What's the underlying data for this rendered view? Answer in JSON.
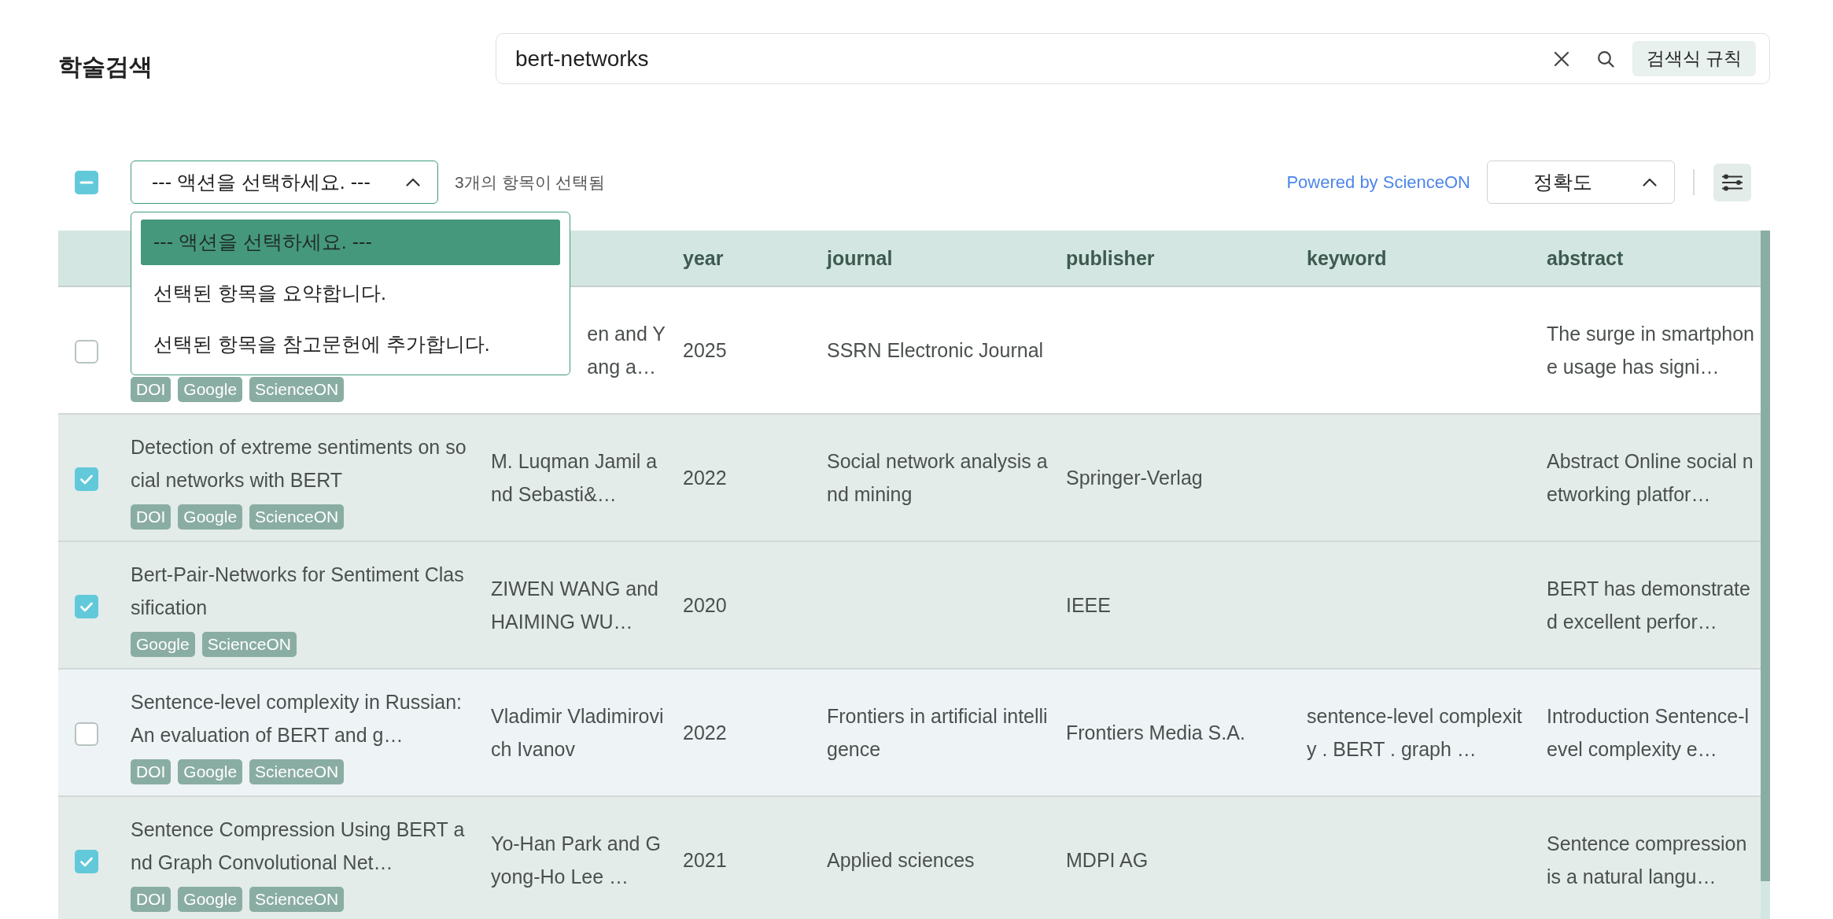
{
  "page_title": "학술검색",
  "search": {
    "value": "bert-networks",
    "rules_button": "검색식 규칙"
  },
  "toolbar": {
    "select_all": {
      "indeterminate": true
    },
    "action_select": {
      "value": "--- 액션을 선택하세요. ---",
      "expanded": true,
      "options": [
        {
          "label": "--- 액션을 선택하세요. ---",
          "selected": true
        },
        {
          "label": "선택된 항목을 요약합니다.",
          "selected": false
        },
        {
          "label": "선택된 항목을 참고문헌에 추가합니다.",
          "selected": false
        }
      ]
    },
    "selection_count": "3개의 항목이 선택됨",
    "powered_by": "Powered by ScienceON",
    "sort_select": {
      "value": "정확도"
    }
  },
  "table": {
    "columns": [
      "year",
      "journal",
      "publisher",
      "keyword",
      "abstract"
    ],
    "rows": [
      {
        "selected": false,
        "column_1": {
          "links": [
            "DOI",
            "Google",
            "ScienceON"
          ]
        },
        "column_2": "en and Y\nang a…",
        "cells": [
          "2025",
          "SSRN Electronic Journal",
          null,
          null,
          "The surge in smartphone usage has signi…"
        ]
      },
      {
        "selected": true,
        "column_1": {
          "text": "Detection of extreme sentiments on social networks with BERT",
          "links": [
            "DOI",
            "Google",
            "ScienceON"
          ]
        },
        "column_2": "M. Luqman Jamil and Sebasti&…",
        "cells": [
          "2022",
          "Social network analysis and mining",
          "Springer-Verlag",
          null,
          "Abstract Online social networking platfor…"
        ]
      },
      {
        "selected": true,
        "column_1": {
          "text": "Bert-Pair-Networks for Sentiment Classification",
          "links": [
            "Google",
            "ScienceON"
          ]
        },
        "column_2": "ZIWEN WANG and HAIMING WU…",
        "cells": [
          "2020",
          null,
          "IEEE",
          null,
          "BERT has demonstrated excellent perfor…"
        ]
      },
      {
        "selected": false,
        "column_1": {
          "text": "Sentence-level complexity in Russian: An evaluation of BERT and g…",
          "links": [
            "DOI",
            "Google",
            "ScienceON"
          ]
        },
        "column_2": "Vladimir Vladimirovich Ivanov",
        "cells": [
          "2022",
          "Frontiers in artificial intelligence",
          "Frontiers Media S.A.",
          "sentence-level complexity . BERT . graph …",
          "Introduction Sentence-level complexity e…"
        ]
      },
      {
        "selected": true,
        "column_1": {
          "text": "Sentence Compression Using BERT and Graph Convolutional Net…",
          "links": [
            "DOI",
            "Google",
            "ScienceON"
          ]
        },
        "column_2": "Yo-Han Park and Gyong-Ho Lee …",
        "cells": [
          "2021",
          "Applied sciences",
          "MDPI AG",
          null,
          "Sentence compression is a natural langu…"
        ]
      }
    ]
  }
}
